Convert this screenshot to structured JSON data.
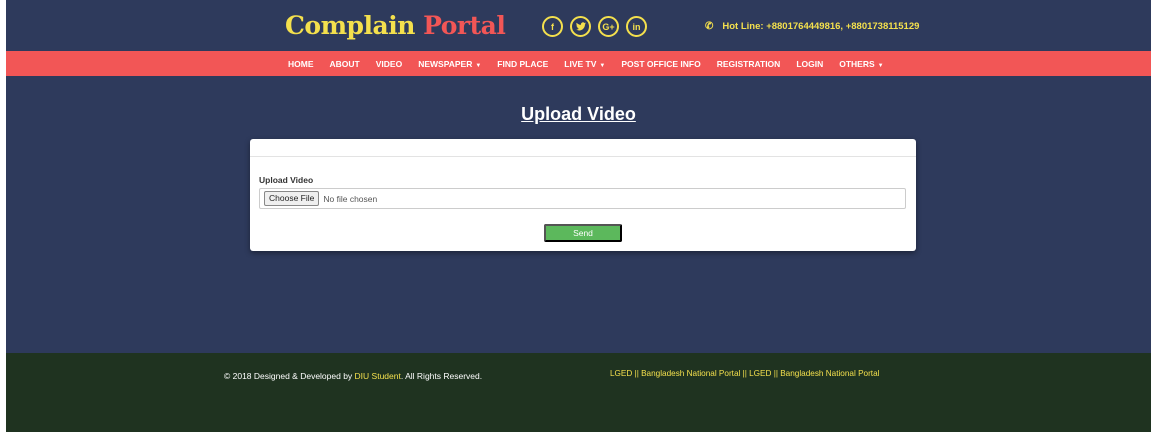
{
  "header": {
    "brand_part1": "Complain",
    "brand_part2": "Portal",
    "social": [
      {
        "icon": "facebook-icon",
        "glyph": "f"
      },
      {
        "icon": "twitter-icon",
        "glyph": "🐦"
      },
      {
        "icon": "google-plus-icon",
        "glyph": "G+"
      },
      {
        "icon": "linkedin-icon",
        "glyph": "in"
      }
    ],
    "phone_icon": "phone-icon",
    "hotline": "Hot Line: +8801764449816, +8801738115129"
  },
  "nav": {
    "items": [
      "HOME",
      "ABOUT",
      "VIDEO",
      "NEWSPAPER",
      "FIND PLACE",
      "LIVE TV",
      "POST OFFICE INFO",
      "REGISTRATION",
      "LOGIN",
      "OTHERS"
    ],
    "dropdown_caret": "▼"
  },
  "main": {
    "title": "Upload Video",
    "form": {
      "label": "Upload Video",
      "choose_button": "Choose File",
      "file_status": "No file chosen",
      "send_button": "Send"
    }
  },
  "footer": {
    "copyright_prefix": "© 2018 Designed & Developed by ",
    "copyright_link": "DIU Student",
    "copyright_suffix": ". All Rights Reserved.",
    "links": "LGED || Bangladesh National Portal || LGED || Bangladesh National Portal"
  },
  "colors": {
    "page_bg": "#2e3a5c",
    "nav_bg": "#f25656",
    "accent_yellow": "#f4e04d",
    "send_green": "#5cb85c",
    "footer_bg": "#1f3320"
  }
}
